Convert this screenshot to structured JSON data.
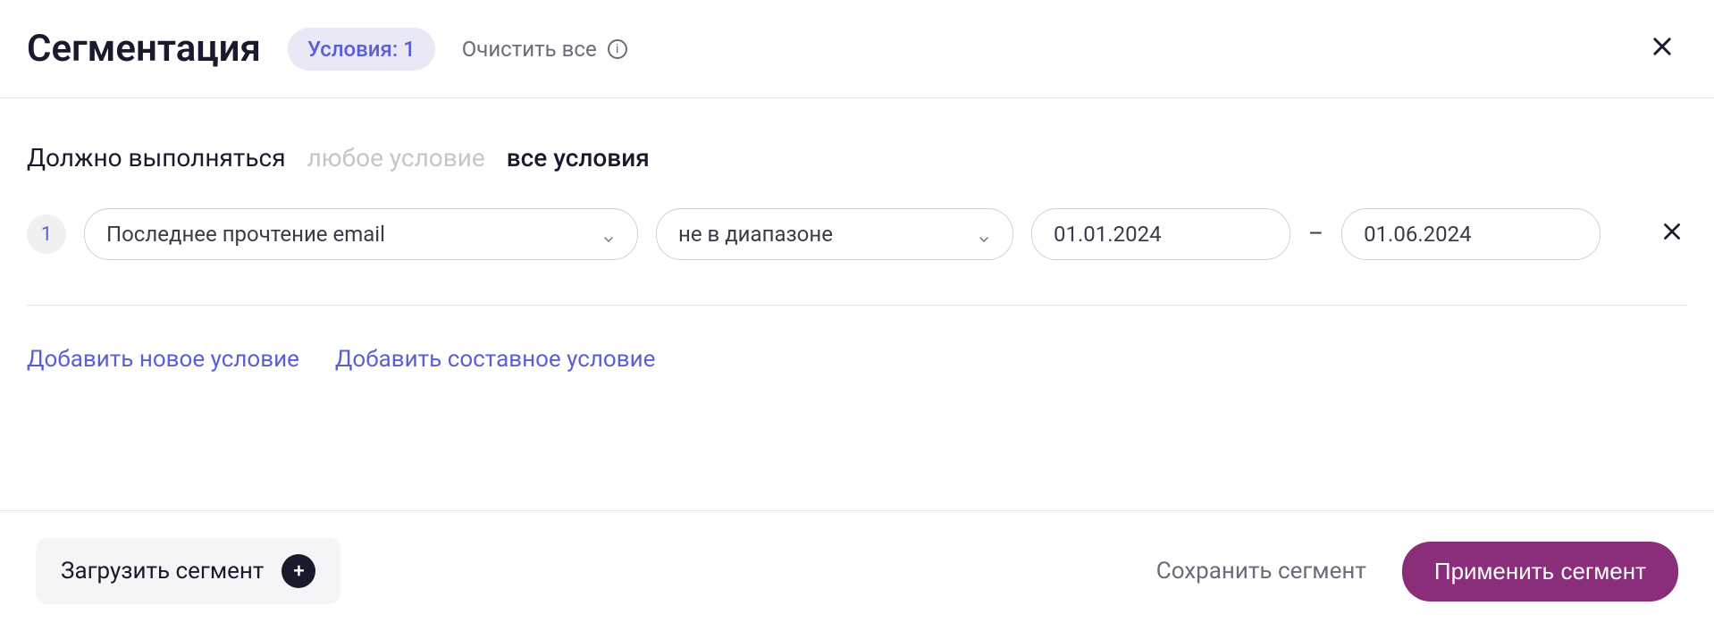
{
  "header": {
    "title": "Сегментация",
    "badge": "Условия: 1",
    "clear_all": "Очистить все"
  },
  "condition_mode": {
    "label": "Должно выполняться",
    "any": "любое условие",
    "all": "все условия"
  },
  "conditions": [
    {
      "number": "1",
      "field": "Последнее прочтение email",
      "operator": "не в диапазоне",
      "date_from": "01.01.2024",
      "date_to": "01.06.2024"
    }
  ],
  "date_separator": "–",
  "add_links": {
    "new_condition": "Добавить новое условие",
    "compound_condition": "Добавить составное условие"
  },
  "footer": {
    "load_segment": "Загрузить сегмент",
    "save_segment": "Сохранить сегмент",
    "apply_segment": "Применить сегмент"
  }
}
